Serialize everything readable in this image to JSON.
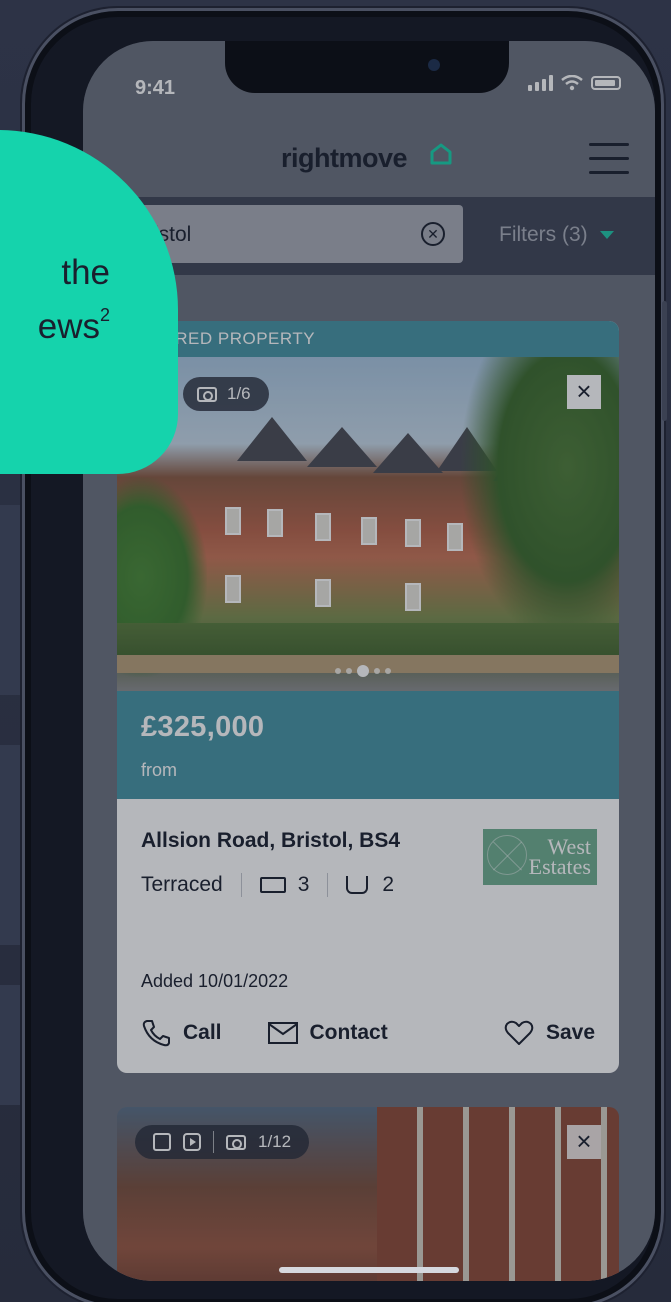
{
  "status": {
    "time": "9:41"
  },
  "header": {
    "logo": "rightmove"
  },
  "search": {
    "value": "Bristol",
    "filters_label": "Filters (3)"
  },
  "promo": {
    "line1": "the",
    "line2": "ews",
    "sup": "2"
  },
  "featured_card": {
    "badge": "ATURED PROPERTY",
    "photo_counter": "1/6",
    "price": "£325,000",
    "price_qualifier": "from",
    "address": "Allsion Road, Bristol, BS4",
    "property_type": "Terraced",
    "bedrooms": "3",
    "bathrooms": "2",
    "agent_line1": "West",
    "agent_line2": "Estates",
    "added": "Added 10/01/2022",
    "actions": {
      "call": "Call",
      "contact": "Contact",
      "save": "Save"
    }
  },
  "second_card": {
    "photo_counter": "1/12"
  },
  "colors": {
    "brand_teal": "#4694a4",
    "promo_green": "#15d3ac",
    "accent_triangle": "#1fc7a8"
  }
}
